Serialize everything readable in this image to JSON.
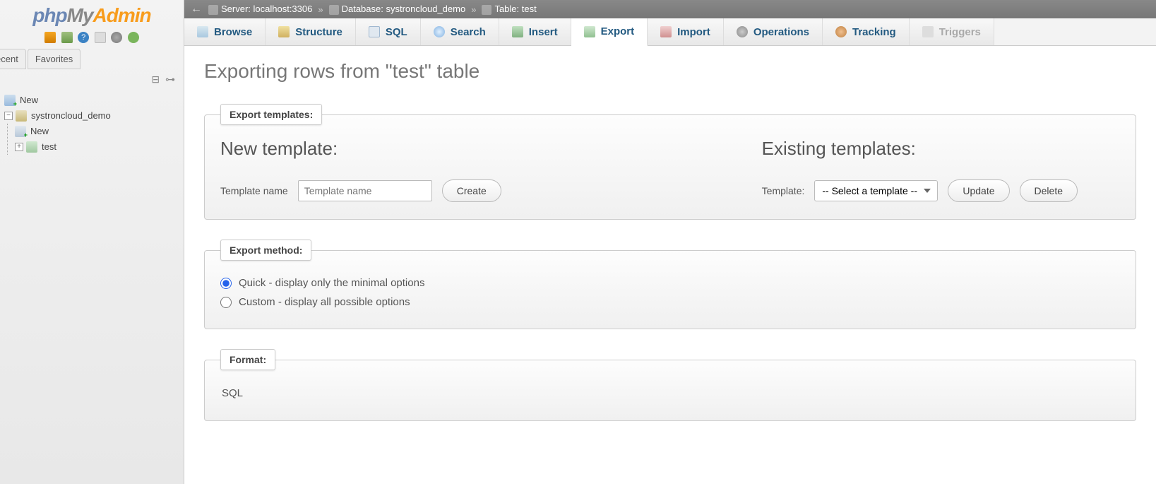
{
  "logo": {
    "p1": "php",
    "p2": "My",
    "p3": "Admin"
  },
  "sidebar": {
    "tabs": [
      "ecent",
      "Favorites"
    ],
    "tree": {
      "new_label": "New",
      "db_label": "systroncloud_demo",
      "db_children": {
        "new": "New",
        "table": "test"
      }
    }
  },
  "breadcrumb": {
    "server_label": "Server: localhost:3306",
    "database_label": "Database: systroncloud_demo",
    "table_label": "Table: test"
  },
  "tabs": {
    "browse": "Browse",
    "structure": "Structure",
    "sql": "SQL",
    "search": "Search",
    "insert": "Insert",
    "export": "Export",
    "import": "Import",
    "operations": "Operations",
    "tracking": "Tracking",
    "triggers": "Triggers"
  },
  "page": {
    "title": "Exporting rows from \"test\" table"
  },
  "templates": {
    "legend": "Export templates:",
    "new_heading": "New template:",
    "existing_heading": "Existing templates:",
    "name_label": "Template name",
    "name_placeholder": "Template name",
    "create_btn": "Create",
    "template_label": "Template:",
    "select_placeholder": "-- Select a template --",
    "update_btn": "Update",
    "delete_btn": "Delete"
  },
  "method": {
    "legend": "Export method:",
    "quick": "Quick - display only the minimal options",
    "custom": "Custom - display all possible options"
  },
  "format": {
    "legend": "Format:",
    "value": "SQL"
  }
}
